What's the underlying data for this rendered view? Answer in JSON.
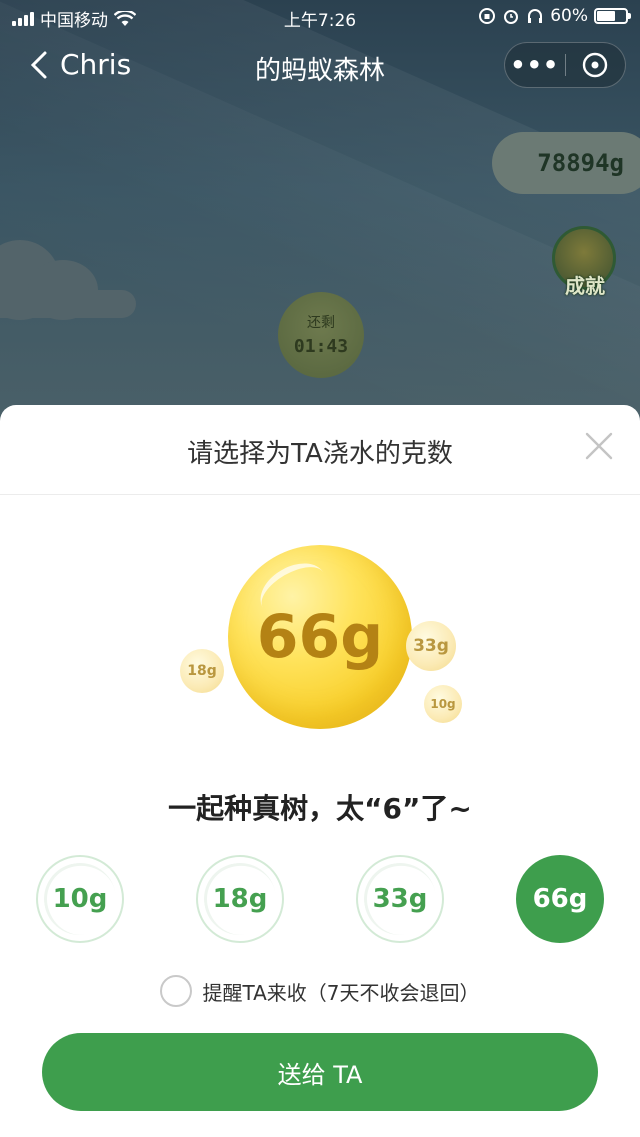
{
  "status_bar": {
    "carrier": "中国移动",
    "time": "上午7:26",
    "battery": "60%"
  },
  "nav": {
    "back_label": "Chris",
    "title": "的蚂蚁森林"
  },
  "background": {
    "energy_total": "78894g",
    "achievement_label": "成就",
    "timer_label": "还剩",
    "timer_value": "01:43"
  },
  "sheet": {
    "title": "请选择为TA浇水的克数",
    "hero": {
      "selected_amount": "66g",
      "bubble_a": "18g",
      "bubble_b": "33g",
      "bubble_c": "10g"
    },
    "slogan": "一起种真树，太“6”了~",
    "choices": [
      {
        "label": "10g",
        "selected": false
      },
      {
        "label": "18g",
        "selected": false
      },
      {
        "label": "33g",
        "selected": false
      },
      {
        "label": "66g",
        "selected": true
      }
    ],
    "remind_label": "提醒TA来收（7天不收会退回）",
    "send_label": "送给 TA"
  },
  "colors": {
    "accent_green": "#3e9e4d",
    "gold": "#f8cf2a"
  }
}
